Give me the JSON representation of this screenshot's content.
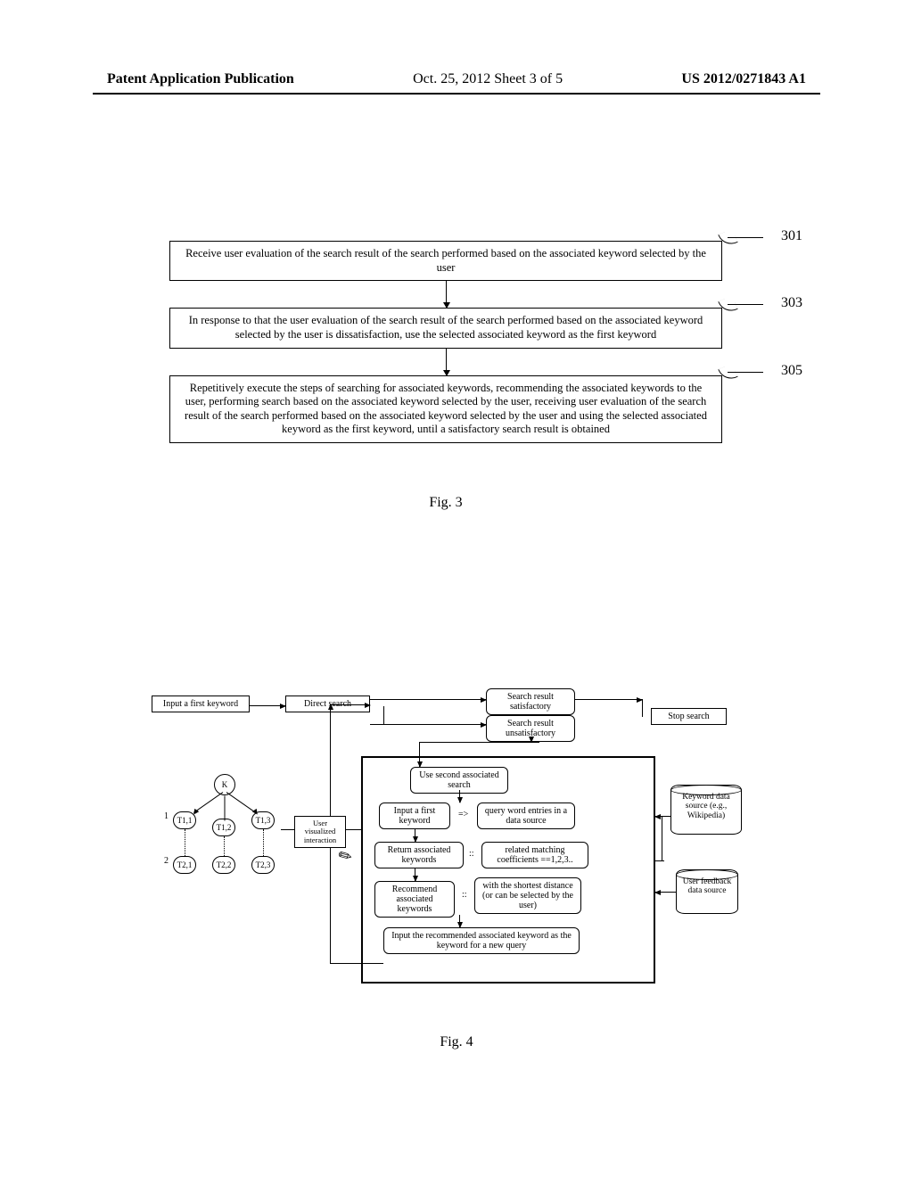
{
  "header": {
    "left": "Patent Application Publication",
    "center": "Oct. 25, 2012  Sheet 3 of 5",
    "right": "US 2012/0271843 A1"
  },
  "fig3": {
    "labels": {
      "s301": "301",
      "s303": "303",
      "s305": "305"
    },
    "box1": "Receive user evaluation of the search result of the search performed based on the associated keyword selected by the user",
    "box2": "In response to that the user evaluation of the search result of the search performed based on the associated keyword selected by the user is dissatisfaction, use the selected associated keyword as the first keyword",
    "box3": "Repetitively execute the steps of searching for associated keywords, recommending the associated keywords to the user, performing search based on the associated keyword selected by the user, receiving user evaluation of the search result of the search performed based on the associated keyword selected by the user and using the selected associated keyword as the first keyword, until a satisfactory search result is obtained",
    "caption": "Fig. 3"
  },
  "fig4": {
    "input_first": "Input a first keyword",
    "direct_search": "Direct search",
    "result_sat": "Search result satisfactory",
    "result_unsat": "Search result unsatisfactory",
    "stop_search": "Stop search",
    "use_second": "Use second associated search",
    "input_first2": "Input a first keyword",
    "query_entries": "query word entries in a data source",
    "return_assoc": "Return associated keywords",
    "related_match": "related matching coefficients ==1,2,3..",
    "recommend": "Recommend associated keywords",
    "shortest": "with the shortest distance (or can be selected by the user)",
    "input_recommended": "Input the recommended associated keyword as the keyword for a new query",
    "keyword_ds": "Keyword data source (e.g., Wikipedia)",
    "user_feedback": "User feedback data source",
    "user_viz": "User visualized interaction",
    "arrow_eq": "=>",
    "colon1": "::",
    "colon2": "::",
    "tree": {
      "root": "K",
      "l1": "1",
      "l2": "2",
      "n11": "T1,1",
      "n12": "T1,2",
      "n13": "T1,3",
      "n21": "T2,1",
      "n22": "T2,2",
      "n23": "T2,3"
    },
    "caption": "Fig. 4"
  }
}
